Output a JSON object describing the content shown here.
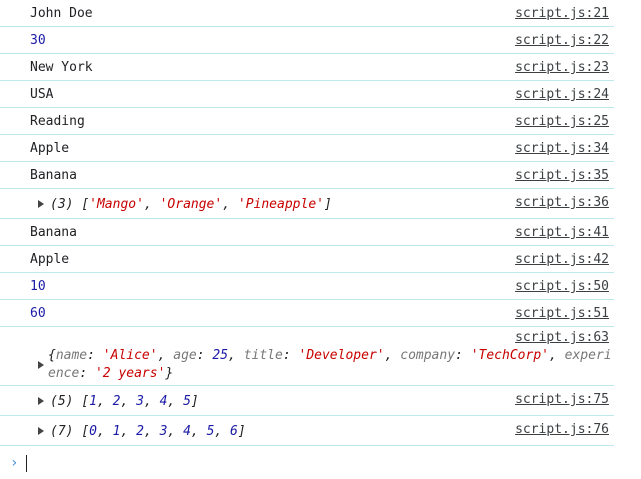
{
  "logs": [
    {
      "text": "John Doe",
      "type": "text",
      "source": "script.js:21"
    },
    {
      "text": "30",
      "type": "number",
      "source": "script.js:22"
    },
    {
      "text": "New York",
      "type": "text",
      "source": "script.js:23"
    },
    {
      "text": "USA",
      "type": "text",
      "source": "script.js:24"
    },
    {
      "text": "Reading",
      "type": "text",
      "source": "script.js:25"
    },
    {
      "text": "Apple",
      "type": "text",
      "source": "script.js:34"
    },
    {
      "text": "Banana",
      "type": "text",
      "source": "script.js:35"
    }
  ],
  "array_log_1": {
    "count": "(3)",
    "items": [
      "'Mango'",
      "'Orange'",
      "'Pineapple'"
    ],
    "source": "script.js:36"
  },
  "logs2": [
    {
      "text": "Banana",
      "type": "text",
      "source": "script.js:41"
    },
    {
      "text": "Apple",
      "type": "text",
      "source": "script.js:42"
    },
    {
      "text": "10",
      "type": "number",
      "source": "script.js:50"
    },
    {
      "text": "60",
      "type": "number",
      "source": "script.js:51"
    }
  ],
  "object_log": {
    "source": "script.js:63",
    "pairs": [
      {
        "key": "name",
        "value": "'Alice'",
        "vtype": "string"
      },
      {
        "key": "age",
        "value": "25",
        "vtype": "number"
      },
      {
        "key": "title",
        "value": "'Developer'",
        "vtype": "string"
      },
      {
        "key": "company",
        "value": "'TechCorp'",
        "vtype": "string"
      },
      {
        "key": "experience",
        "value": "'2 years'",
        "vtype": "string"
      }
    ]
  },
  "array_log_2": {
    "count": "(5)",
    "items": [
      "1",
      "2",
      "3",
      "4",
      "5"
    ],
    "source": "script.js:75"
  },
  "array_log_3": {
    "count": "(7)",
    "items": [
      "0",
      "1",
      "2",
      "3",
      "4",
      "5",
      "6"
    ],
    "source": "script.js:76"
  },
  "prompt": {
    "symbol": "›"
  },
  "colors": {
    "number": "#1a1aa6",
    "string": "#c80000",
    "separator": "#bfe8ec"
  }
}
